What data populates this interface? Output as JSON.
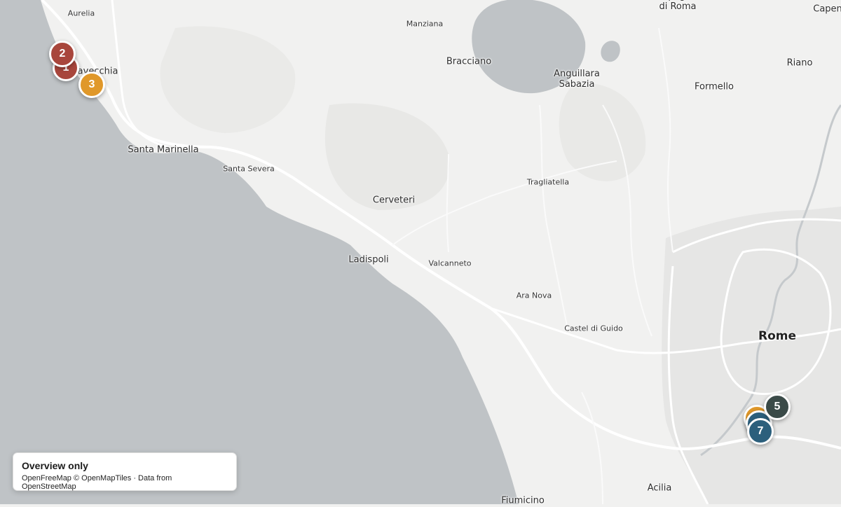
{
  "map": {
    "places": {
      "aurelia": "Aurelia",
      "manziana": "Manziana",
      "campagnano": "Campagnano\ndi Roma",
      "capena": "Capena",
      "civitavecchia": "Civitavecchia",
      "bracciano": "Bracciano",
      "anguillara": "Anguillara\nSabazia",
      "riano": "Riano",
      "formello": "Formello",
      "santa_marinella": "Santa Marinella",
      "santa_severa": "Santa Severa",
      "trigliatella": "Tragliatella",
      "cerveteri": "Cerveteri",
      "ladispoli": "Ladispoli",
      "valcanneto": "Valcanneto",
      "ara_nova": "Ara Nova",
      "castel_di_guido": "Castel di Guido",
      "rome": "Rome",
      "acilia": "Acilia",
      "fiumicino": "Fiumicino"
    },
    "markers": [
      {
        "label": "1",
        "color": "#a8463c"
      },
      {
        "label": "2",
        "color": "#a8463c"
      },
      {
        "label": "3",
        "color": "#e0982a"
      },
      {
        "label": "",
        "color": "#e0982a"
      },
      {
        "label": "",
        "color": "#2c5f7c"
      },
      {
        "label": "5",
        "color": "#3a4a48"
      },
      {
        "label": "7",
        "color": "#2c5f7c"
      }
    ]
  },
  "attribution": {
    "title": "Overview only",
    "text": "OpenFreeMap © OpenMapTiles · Data from OpenStreetMap"
  }
}
